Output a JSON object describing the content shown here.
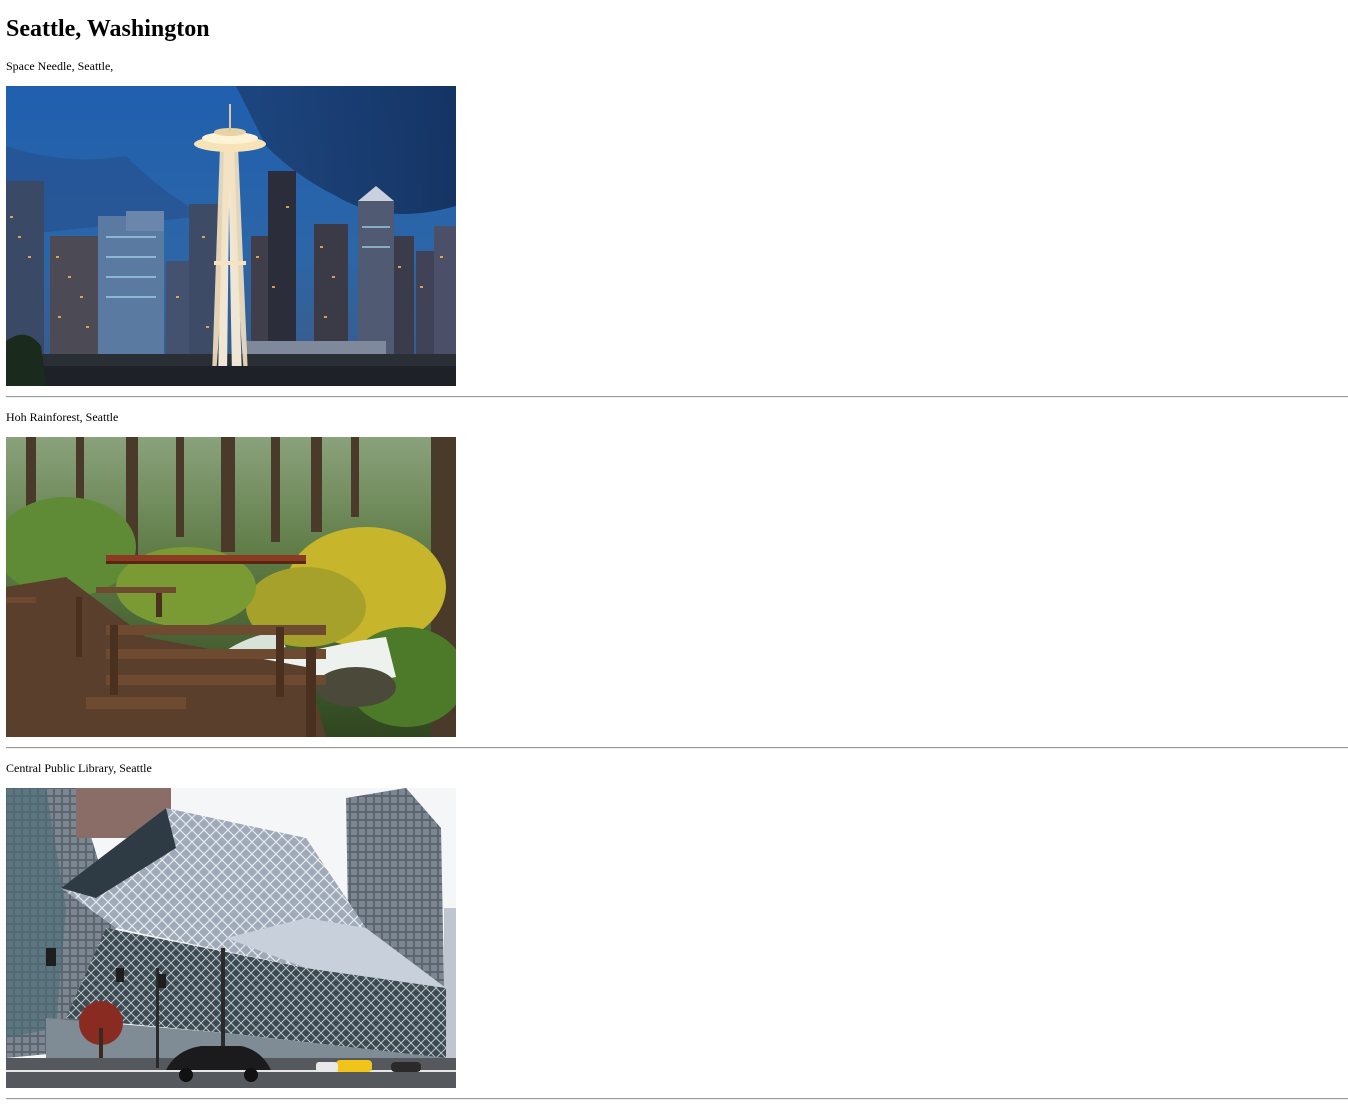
{
  "page": {
    "title": "Seattle, Washington"
  },
  "sections": [
    {
      "caption": "Space Needle, Seattle,",
      "image_subject": "space-needle-skyline"
    },
    {
      "caption": "Hoh Rainforest, Seattle",
      "image_subject": "rainforest-waterfall-bridge"
    },
    {
      "caption": "Central Public Library, Seattle",
      "image_subject": "central-library-building"
    }
  ]
}
